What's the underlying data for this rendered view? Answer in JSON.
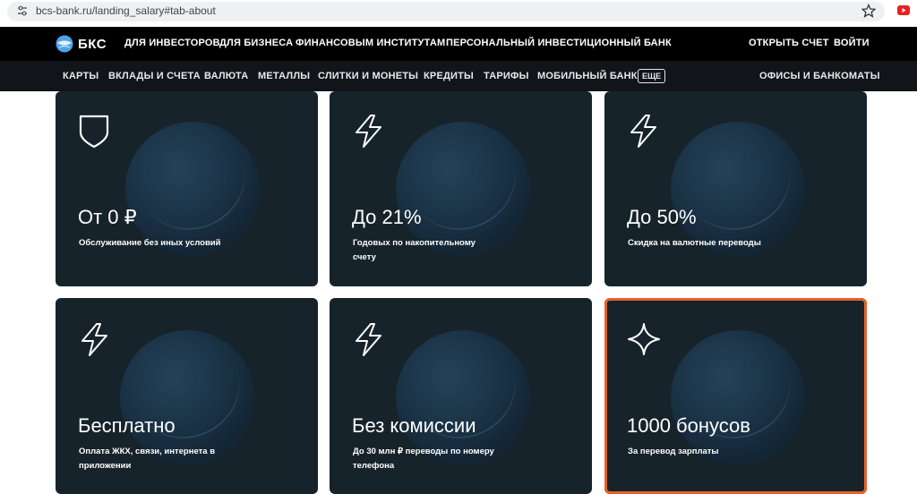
{
  "browser": {
    "url": "bcs-bank.ru/landing_salary#tab-about",
    "icons": {
      "site": "tune-icon",
      "bookmark": "star-icon",
      "extension": "youtube-icon"
    }
  },
  "topnav": {
    "logo_text": "БКС",
    "items": [
      "ДЛЯ ИНВЕСТОРОВ",
      "ДЛЯ БИЗНЕСА",
      "ФИНАНСОВЫМ ИНСТИТУТАМ",
      "ПЕРСОНАЛЬНЫЙ ИНВЕСТИЦИОННЫЙ БАНК"
    ],
    "open_account": "ОТКРЫТЬ СЧЕТ",
    "login": "ВОЙТИ"
  },
  "subnav": {
    "items": [
      "КАРТЫ",
      "ВКЛАДЫ И СЧЕТА",
      "ВАЛЮТА",
      "МЕТАЛЛЫ",
      "СЛИТКИ И МОНЕТЫ",
      "КРЕДИТЫ",
      "ТАРИФЫ",
      "МОБИЛЬНЫЙ БАНК"
    ],
    "more": "ЕЩЕ",
    "offices": "ОФИСЫ И БАНКОМАТЫ"
  },
  "cards": [
    {
      "icon": "shield-icon",
      "value": "От 0 ₽",
      "desc": "Обслуживание без иных условий"
    },
    {
      "icon": "lightning-icon",
      "value": "До 21%",
      "desc": "Годовых по накопительному счету"
    },
    {
      "icon": "lightning-icon",
      "value": "До 50%",
      "desc": "Скидка на валютные переводы"
    },
    {
      "icon": "lightning-icon",
      "value": "Бесплатно",
      "desc": "Оплата ЖКХ, связи, интернета в приложении"
    },
    {
      "icon": "lightning-icon",
      "value": "Без комиссии",
      "desc": "До 30 млн ₽ переводы по номеру телефона"
    },
    {
      "icon": "sparkle-icon",
      "value": "1000 бонусов",
      "desc": "За перевод зарплаты"
    }
  ],
  "colors": {
    "card_bg": "#17232b",
    "highlight": "#e6612b",
    "topnav_bg": "#000000",
    "subnav_bg": "#111418"
  }
}
